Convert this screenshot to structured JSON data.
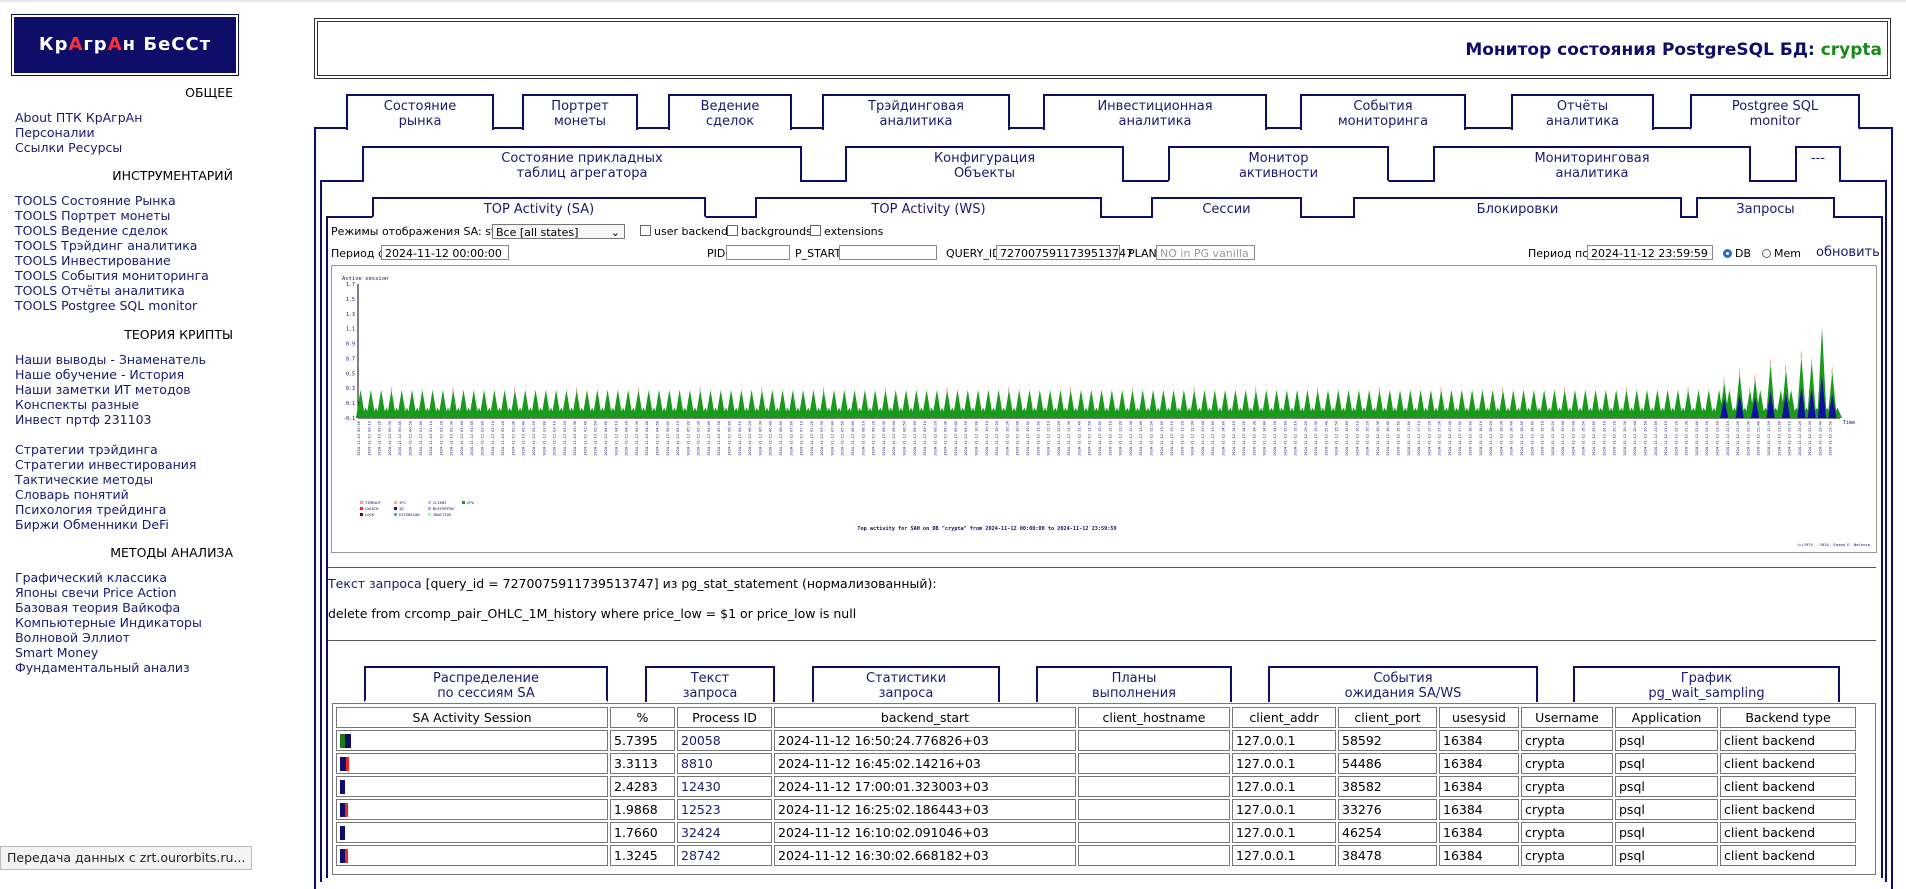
{
  "logo": {
    "parts": [
      {
        "t": "К",
        "r": false
      },
      {
        "t": "р",
        "r": false
      },
      {
        "t": "А",
        "r": true
      },
      {
        "t": "гр",
        "r": false
      },
      {
        "t": "А",
        "r": true
      },
      {
        "t": "н БеССт",
        "r": false
      }
    ]
  },
  "sidebar": {
    "sections": [
      {
        "title": "ОБЩЕЕ",
        "items": [
          "About ПТК КрАгрАн",
          "Персоналии",
          "Ссылки Ресурсы"
        ]
      },
      {
        "title": "ИНСТРУМЕНТАРИЙ",
        "items": [
          "TOOLS Состояние Рынка",
          "TOOLS Портрет монеты",
          "TOOLS Ведение сделок",
          "TOOLS Трэйдинг аналитика",
          "TOOLS Инвестирование",
          "TOOLS События мониторинга",
          "TOOLS Отчёты аналитика",
          "TOOLS Postgree SQL monitor"
        ]
      },
      {
        "title": "ТЕОРИЯ КРИПТЫ",
        "items": [
          "Наши выводы - Знаменатель",
          "Наше обучение - История",
          "Наши заметки ИТ методов",
          "Конспекты разные",
          "Инвест пртф 231103",
          "",
          "Стратегии трэйдинга",
          "Стратегии инвестирования",
          "Тактические методы",
          "Словарь понятий",
          "Психология трейдинга",
          "Биржи Обменники DeFi"
        ]
      },
      {
        "title": "МЕТОДЫ АНАЛИЗА",
        "items": [
          "Графический классика",
          "Японы свечи Price Action",
          "Базовая теория Вайкофа",
          "Компьютерные Индикаторы",
          "Волновой Эллиот",
          "Smart Money",
          "Фундаментальный анализ"
        ]
      }
    ]
  },
  "header": {
    "title": "Монитор состояния PostgreSQL БД: ",
    "db": "crypta"
  },
  "tabs_main": [
    {
      "l1": "Состояние",
      "l2": "рынка"
    },
    {
      "l1": "Портрет",
      "l2": "монеты"
    },
    {
      "l1": "Ведение",
      "l2": "сделок"
    },
    {
      "l1": "Трэйдинговая",
      "l2": "аналитика"
    },
    {
      "l1": "Инвестиционная",
      "l2": "аналитика"
    },
    {
      "l1": "События",
      "l2": "мониторинга"
    },
    {
      "l1": "Отчёты",
      "l2": "аналитика"
    },
    {
      "l1": "Postgree SQL",
      "l2": "monitor"
    }
  ],
  "tabs_sub": [
    {
      "l1": "Состояние прикладных",
      "l2": "таблиц агрегатора"
    },
    {
      "l1": "Конфигурация",
      "l2": "Объекты"
    },
    {
      "l1": "Монитор",
      "l2": "активности"
    },
    {
      "l1": "Мониторинговая",
      "l2": "аналитика"
    },
    {
      "l1": "---",
      "l2": ""
    }
  ],
  "tabs_inner": [
    "TOP Activity (SA)",
    "TOP Activity (WS)",
    "Сессии",
    "Блокировки",
    "Запросы"
  ],
  "filters": {
    "mode_label": "Режимы отображения SA: state",
    "mode_value": "Все [all states]",
    "cb_user": "user backends",
    "cb_bg": "backgrounds",
    "cb_ext": "extensions",
    "period_from_label": "Период с",
    "period_from": "2024-11-12 00:00:00",
    "pid_label": "PID",
    "pstart_label": "P_START",
    "qid_label": "QUERY_ID",
    "qid_value": "7270075911739513747",
    "plan_label": "PLAN",
    "plan_placeholder": "NO in PG vanilla",
    "period_to_label": "Период по",
    "period_to": "2024-11-12 23:59:59",
    "radio_db": "DB",
    "radio_mem": "Mem",
    "refresh": "обновить"
  },
  "chart_data": {
    "type": "area",
    "title": "Top activity for SAH on DB \"crypta\" from 2024-11-12 00:00:00 to 2024-11-12 23:59:59",
    "ylabel": "Active session",
    "xlabel": "Time",
    "ylim": [
      -0.1,
      1.7
    ],
    "yticks": [
      -0.1,
      0.1,
      0.3,
      0.5,
      0.7,
      0.9,
      1.1,
      1.3,
      1.5,
      1.7
    ],
    "x_start": "2024-11-12 00:00",
    "x_step_minutes": 5,
    "legend": [
      "TIMEOUT",
      "IPC",
      "CLIENT",
      "CPU",
      "LWLOCK",
      "IO",
      "BUFFERPIN",
      "LOCK",
      "EXTENSION",
      "INACTIVE"
    ],
    "legend_colors": [
      "#ff9999",
      "#ffb060",
      "#c0c0ff",
      "#1a9a1a",
      "#ff2020",
      "#1010a0",
      "#c0a0ff",
      "#800000",
      "#60a0ff",
      "#a0ffa0"
    ],
    "copyright": "(c)1974 - 2024, Eaзaq E. Nalovsa",
    "series_summary": {
      "baseline_peak": 0.3,
      "late_peaks": [
        0.6,
        0.75,
        0.9,
        1.05,
        1.65
      ]
    }
  },
  "query": {
    "label": "Текст запроса",
    "meta": " [query_id = 7270075911739513747] из pg_stat_statement (нормализованный):",
    "sql": "delete from crcomp_pair_OHLC_1M_history where price_low = $1 or price_low is null"
  },
  "tabs_bottom": [
    {
      "l1": "Распределение",
      "l2": "по сессиям SA"
    },
    {
      "l1": "Текст",
      "l2": "запроса"
    },
    {
      "l1": "Статистики",
      "l2": "запроса"
    },
    {
      "l1": "Планы",
      "l2": "выполнения"
    },
    {
      "l1": "События",
      "l2": "ожидания SA/WS"
    },
    {
      "l1": "График",
      "l2": "pg_wait_sampling"
    }
  ],
  "table": {
    "headers": [
      "SA Activity Session",
      "%",
      "Process ID",
      "backend_start",
      "client_hostname",
      "client_addr",
      "client_port",
      "usesysid",
      "Username",
      "Application",
      "Backend type"
    ],
    "rows": [
      {
        "bar": [
          [
            "#1a7a1a",
            5
          ],
          [
            "#0e0e68",
            6
          ]
        ],
        "pct": "5.7395",
        "pid": "20058",
        "start": "2024-11-12 16:50:24.776826+03",
        "host": "",
        "addr": "127.0.0.1",
        "port": "58592",
        "sysid": "16384",
        "user": "crypta",
        "app": "psql",
        "type": "client backend"
      },
      {
        "bar": [
          [
            "#0e0e68",
            6
          ],
          [
            "#ff2020",
            3
          ]
        ],
        "pct": "3.3113",
        "pid": "8810",
        "start": "2024-11-12 16:45:02.14216+03",
        "host": "",
        "addr": "127.0.0.1",
        "port": "54486",
        "sysid": "16384",
        "user": "crypta",
        "app": "psql",
        "type": "client backend"
      },
      {
        "bar": [
          [
            "#0e0e68",
            5
          ]
        ],
        "pct": "2.4283",
        "pid": "12430",
        "start": "2024-11-12 17:00:01.323003+03",
        "host": "",
        "addr": "127.0.0.1",
        "port": "38582",
        "sysid": "16384",
        "user": "crypta",
        "app": "psql",
        "type": "client backend"
      },
      {
        "bar": [
          [
            "#0e0e68",
            5
          ],
          [
            "#ff2020",
            3
          ]
        ],
        "pct": "1.9868",
        "pid": "12523",
        "start": "2024-11-12 16:25:02.186443+03",
        "host": "",
        "addr": "127.0.0.1",
        "port": "33276",
        "sysid": "16384",
        "user": "crypta",
        "app": "psql",
        "type": "client backend"
      },
      {
        "bar": [
          [
            "#0e0e68",
            5
          ]
        ],
        "pct": "1.7660",
        "pid": "32424",
        "start": "2024-11-12 16:10:02.091046+03",
        "host": "",
        "addr": "127.0.0.1",
        "port": "46254",
        "sysid": "16384",
        "user": "crypta",
        "app": "psql",
        "type": "client backend"
      },
      {
        "bar": [
          [
            "#0e0e68",
            5
          ],
          [
            "#ff2020",
            3
          ]
        ],
        "pct": "1.3245",
        "pid": "28742",
        "start": "2024-11-12 16:30:02.668182+03",
        "host": "",
        "addr": "127.0.0.1",
        "port": "38478",
        "sysid": "16384",
        "user": "crypta",
        "app": "psql",
        "type": "client backend"
      }
    ]
  },
  "status": "Передача данных с zrt.ourorbits.ru..."
}
